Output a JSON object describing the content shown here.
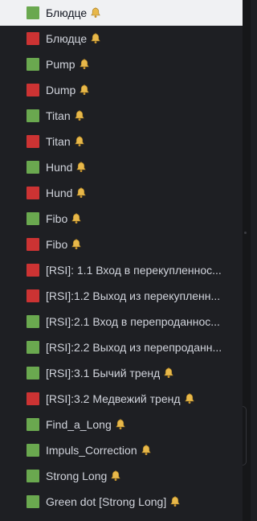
{
  "colors": {
    "green": "#6aa84f",
    "red": "#cc3333",
    "bell": "#e8b84a"
  },
  "items": [
    {
      "label": "Блюдце",
      "color": "green",
      "bell": true,
      "selected": true
    },
    {
      "label": "Блюдце",
      "color": "red",
      "bell": true
    },
    {
      "label": "Pump",
      "color": "green",
      "bell": true
    },
    {
      "label": "Dump",
      "color": "red",
      "bell": true
    },
    {
      "label": "Titan",
      "color": "green",
      "bell": true
    },
    {
      "label": "Titan",
      "color": "red",
      "bell": true
    },
    {
      "label": "Hund",
      "color": "green",
      "bell": true
    },
    {
      "label": "Hund",
      "color": "red",
      "bell": true
    },
    {
      "label": "Fibo",
      "color": "green",
      "bell": true
    },
    {
      "label": "Fibo",
      "color": "red",
      "bell": true
    },
    {
      "label": "[RSI]: 1.1 Вход в перекупленнос...",
      "color": "red",
      "bell": false
    },
    {
      "label": "[RSI]:1.2 Выход из перекупленн...",
      "color": "red",
      "bell": false
    },
    {
      "label": "[RSI]:2.1 Вход в перепроданнос...",
      "color": "green",
      "bell": false
    },
    {
      "label": "[RSI]:2.2 Выход из перепроданн...",
      "color": "green",
      "bell": false
    },
    {
      "label": "[RSI]:3.1 Бычий тренд",
      "color": "green",
      "bell": true
    },
    {
      "label": "[RSI]:3.2 Медвежий тренд",
      "color": "red",
      "bell": true
    },
    {
      "label": "Find_a_Long",
      "color": "green",
      "bell": true
    },
    {
      "label": "Impuls_Correction",
      "color": "green",
      "bell": true
    },
    {
      "label": "Strong Long",
      "color": "green",
      "bell": true
    },
    {
      "label": "Green dot [Strong Long]",
      "color": "green",
      "bell": true
    }
  ]
}
